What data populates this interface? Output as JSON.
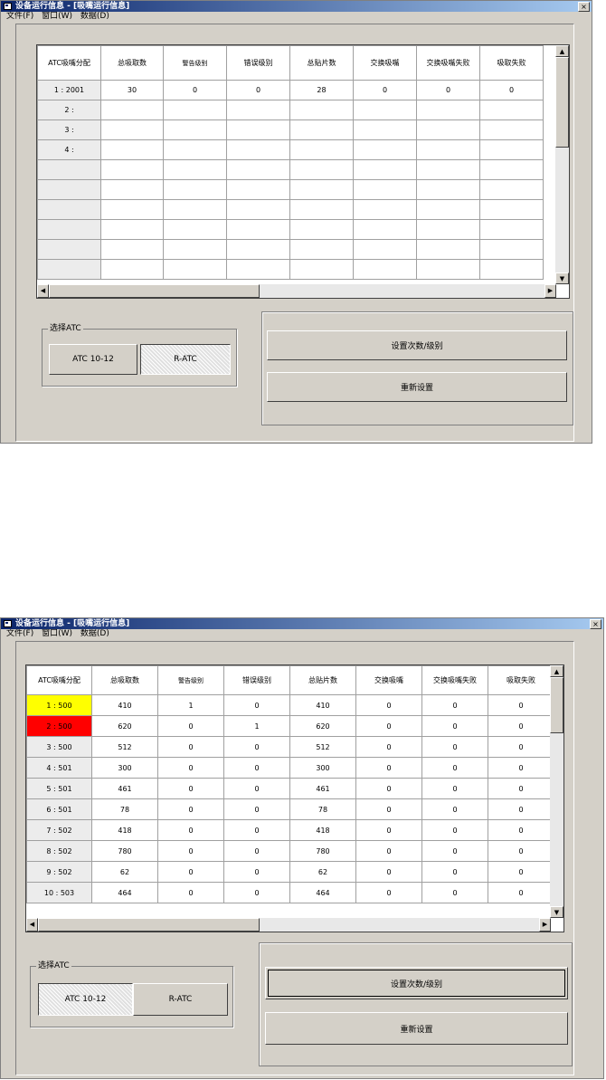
{
  "window1": {
    "title": "设备运行信息 - [吸嘴运行信息]",
    "close_glyph": "×",
    "menu": [
      "文件(F)",
      "窗口(W)",
      "数据(D)"
    ],
    "grid": {
      "columns": [
        "ATC吸嘴分配",
        "总吸取数",
        "警告级别",
        "错误级别",
        "总贴片数",
        "交换吸嘴",
        "交换吸嘴失败",
        "吸取失败"
      ],
      "rows": [
        {
          "label": "1 :   2001",
          "values": [
            "30",
            "0",
            "0",
            "28",
            "0",
            "0",
            "0"
          ]
        },
        {
          "label": "2 :",
          "values": [
            "",
            "",
            "",
            "",
            "",
            "",
            ""
          ]
        },
        {
          "label": "3 :",
          "values": [
            "",
            "",
            "",
            "",
            "",
            "",
            ""
          ]
        },
        {
          "label": "4 :",
          "values": [
            "",
            "",
            "",
            "",
            "",
            "",
            ""
          ]
        },
        {
          "label": "",
          "values": [
            "",
            "",
            "",
            "",
            "",
            "",
            ""
          ]
        },
        {
          "label": "",
          "values": [
            "",
            "",
            "",
            "",
            "",
            "",
            ""
          ]
        },
        {
          "label": "",
          "values": [
            "",
            "",
            "",
            "",
            "",
            "",
            ""
          ]
        },
        {
          "label": "",
          "values": [
            "",
            "",
            "",
            "",
            "",
            "",
            ""
          ]
        },
        {
          "label": "",
          "values": [
            "",
            "",
            "",
            "",
            "",
            "",
            ""
          ]
        },
        {
          "label": "",
          "values": [
            "",
            "",
            "",
            "",
            "",
            "",
            ""
          ]
        }
      ]
    },
    "select_atc": {
      "label": "选择ATC",
      "option1": "ATC 10-12",
      "option2": "R-ATC",
      "selected": "R-ATC"
    },
    "buttons": {
      "set_count_level": "设置次数/级别",
      "reset": "重新设置"
    }
  },
  "window2": {
    "title": "设备运行信息 - [吸嘴运行信息]",
    "close_glyph": "×",
    "menu": [
      "文件(F)",
      "窗口(W)",
      "数据(D)"
    ],
    "grid": {
      "columns": [
        "ATC吸嘴分配",
        "总吸取数",
        "警告级别",
        "错误级别",
        "总贴片数",
        "交换吸嘴",
        "交换吸嘴失败",
        "吸取失败"
      ],
      "rows": [
        {
          "label": "1 :     500",
          "highlight": "yellow",
          "values": [
            "410",
            "1",
            "0",
            "410",
            "0",
            "0",
            "0"
          ]
        },
        {
          "label": "2 :     500",
          "highlight": "red",
          "values": [
            "620",
            "0",
            "1",
            "620",
            "0",
            "0",
            "0"
          ]
        },
        {
          "label": "3 :     500",
          "values": [
            "512",
            "0",
            "0",
            "512",
            "0",
            "0",
            "0"
          ]
        },
        {
          "label": "4 :     501",
          "values": [
            "300",
            "0",
            "0",
            "300",
            "0",
            "0",
            "0"
          ]
        },
        {
          "label": "5 :     501",
          "values": [
            "461",
            "0",
            "0",
            "461",
            "0",
            "0",
            "0"
          ]
        },
        {
          "label": "6 :     501",
          "values": [
            "78",
            "0",
            "0",
            "78",
            "0",
            "0",
            "0"
          ]
        },
        {
          "label": "7 :     502",
          "values": [
            "418",
            "0",
            "0",
            "418",
            "0",
            "0",
            "0"
          ]
        },
        {
          "label": "8 :     502",
          "values": [
            "780",
            "0",
            "0",
            "780",
            "0",
            "0",
            "0"
          ]
        },
        {
          "label": "9 :     502",
          "values": [
            "62",
            "0",
            "0",
            "62",
            "0",
            "0",
            "0"
          ]
        },
        {
          "label": "10 :    503",
          "values": [
            "464",
            "0",
            "0",
            "464",
            "0",
            "0",
            "0"
          ]
        }
      ]
    },
    "select_atc": {
      "label": "选择ATC",
      "option1": "ATC 10-12",
      "option2": "R-ATC",
      "selected": "ATC 10-12"
    },
    "buttons": {
      "set_count_level": "设置次数/级别",
      "reset": "重新设置"
    }
  },
  "icons": {
    "scroll_up": "▲",
    "scroll_down": "▼",
    "scroll_left": "◀",
    "scroll_right": "▶"
  },
  "colors": {
    "titlebar": "#0a246a",
    "window_bg": "#d4d0c8",
    "highlight_yellow": "#ffff00",
    "highlight_red": "#ff0000"
  }
}
